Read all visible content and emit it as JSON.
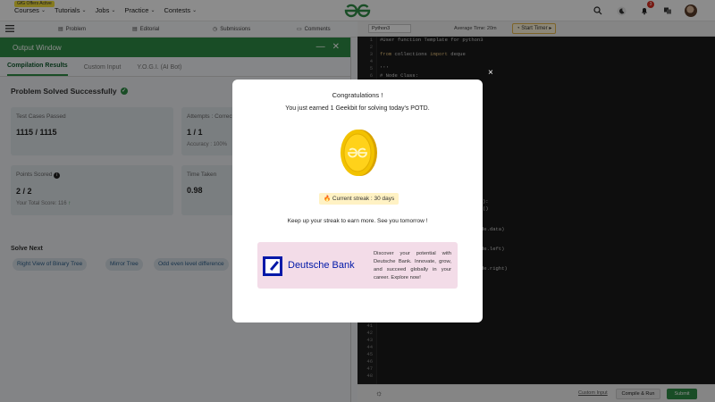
{
  "nav": {
    "offers_badge": "GfG Offers Active",
    "links": [
      {
        "label": "Courses"
      },
      {
        "label": "Tutorials"
      },
      {
        "label": "Jobs"
      },
      {
        "label": "Practice"
      },
      {
        "label": "Contests"
      }
    ],
    "notification_count": "3",
    "icons": [
      "search-icon",
      "dark-mode-icon",
      "bell-icon",
      "translate-icon",
      "avatar"
    ]
  },
  "problem_tabs": [
    {
      "label": "Problem",
      "icon": "problem-icon"
    },
    {
      "label": "Editorial",
      "icon": "editorial-icon"
    },
    {
      "label": "Submissions",
      "icon": "submissions-icon"
    },
    {
      "label": "Comments",
      "icon": "comments-icon"
    }
  ],
  "output": {
    "title": "Output Window",
    "tabs": [
      {
        "label": "Compilation Results",
        "active": true
      },
      {
        "label": "Custom Input",
        "active": false
      },
      {
        "label": "Y.O.G.I. (AI Bot)",
        "active": false
      }
    ],
    "status": "Problem Solved Successfully",
    "test_cases_label": "Test Cases Passed",
    "test_cases_value": "1115 / 1115",
    "attempts_label": "Attempts : Correct / Total",
    "attempts_value": "1 / 1",
    "accuracy_text": "Accuracy : 100%",
    "points_label": "Points Scored",
    "points_value": "2 / 2",
    "total_score_text": "Your Total Score: 116",
    "time_label": "Time Taken",
    "time_value": "0.98",
    "solve_next_label": "Solve Next",
    "solve_next": [
      "Right View of Binary Tree",
      "Mirror Tree",
      "Odd even level difference"
    ]
  },
  "editor": {
    "language": "Python3",
    "average_time": "Average Time: 20m",
    "start_timer": "Start Timer",
    "line_numbers": [
      "1",
      "2",
      "3",
      "4",
      "5",
      "6",
      "7",
      "8",
      "9",
      "10",
      "11",
      "12",
      "13",
      "14",
      "15",
      "16",
      "17",
      "18",
      "19",
      "20",
      "21",
      "22",
      "23",
      "24",
      "25",
      "26",
      "27",
      "28",
      "29",
      "30",
      "31",
      "32",
      "33",
      "34",
      "35",
      "36",
      "37",
      "38",
      "39",
      "40",
      "41",
      "42",
      "43",
      "44",
      "45",
      "46",
      "47",
      "48"
    ],
    "code_line1": "#User function Template for python3",
    "code_kw_from": "from",
    "code_mod": "collections",
    "code_kw_import": "import",
    "code_name": "deque",
    "code_line5": "'''",
    "code_line6": "# Node Class:",
    "frag1": "):",
    "frag2": "()",
    "frag3": "de.data)",
    "frag4": "de.left)",
    "frag5": "de.right)",
    "custom_input_link": "Custom Input",
    "compile_run": "Compile & Run",
    "submit": "Submit"
  },
  "modal": {
    "title": "Congratulations !",
    "earned": "You just earned 1 Geekbit for solving today's POTD.",
    "streak": "Current streak : 30 days",
    "keep_up": "Keep up your streak to earn more. See you tomorrow !",
    "close": "×",
    "promo_brand": "Deutsche Bank",
    "promo_text": "Discover your potential with Deutsche Bank. Innovate, grow, and succeed globally in your career. Explore now!"
  },
  "colors": {
    "brand_green": "#2f8d46",
    "editor_bg": "#1a1a1a",
    "promo_bg": "#f3dce8",
    "db_blue": "#0018a8"
  }
}
